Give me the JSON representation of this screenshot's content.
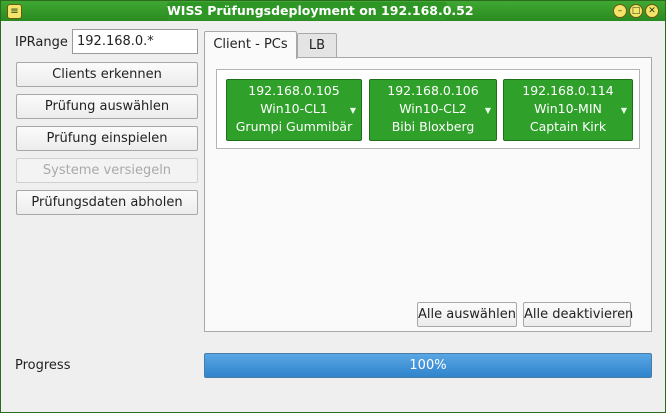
{
  "window": {
    "title": "WISS Prüfungsdeployment on 192.168.0.52"
  },
  "left": {
    "iprange_label": "IPRange",
    "iprange_value": "192.168.0.*",
    "buttons": {
      "clients_erkennen": "Clients erkennen",
      "pruefung_auswaehlen": "Prüfung auswählen",
      "pruefung_einspielen": "Prüfung einspielen",
      "systeme_versiegeln": "Systeme versiegeln",
      "pruefungsdaten_abholen": "Prüfungsdaten abholen"
    }
  },
  "tabs": [
    {
      "label": "Client - PCs",
      "active": true
    },
    {
      "label": "LB",
      "active": false
    }
  ],
  "clients": [
    {
      "ip": "192.168.0.105",
      "host": "Win10-CL1",
      "user": "Grumpi Gummibär"
    },
    {
      "ip": "192.168.0.106",
      "host": "Win10-CL2",
      "user": "Bibi Bloxberg"
    },
    {
      "ip": "192.168.0.114",
      "host": "Win10-MIN",
      "user": "Captain Kirk"
    }
  ],
  "actions": {
    "select_all": "Alle auswählen",
    "deselect_all": "Alle deaktivieren"
  },
  "progress": {
    "label": "Progress",
    "text": "100%",
    "value_percent": 100
  },
  "colors": {
    "titlebar": "#2e9624",
    "client_tile": "#2fa12a",
    "progress": "#3a8fd6"
  },
  "icons": {
    "title_left": "app-menu-icon",
    "title_right": [
      "minimize-icon",
      "maximize-icon",
      "close-icon"
    ]
  }
}
